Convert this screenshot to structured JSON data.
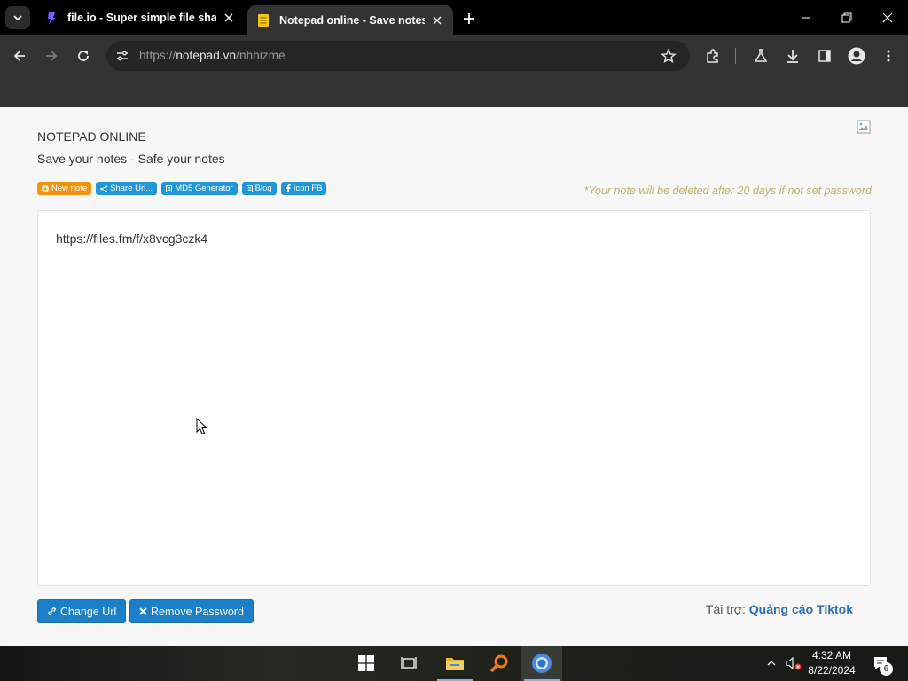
{
  "browser": {
    "tabs": [
      {
        "title": "file.io - Super simple file sharing",
        "active": false
      },
      {
        "title": "Notepad online - Save notes online",
        "active": true
      }
    ],
    "url_scheme": "https://",
    "url_host": "notepad.vn",
    "url_path": "/nhhizme"
  },
  "page": {
    "brand": "NOTEPAD ONLINE",
    "tagline": "Save your notes - Safe your notes",
    "chips": [
      {
        "label": "New note",
        "icon": "plus-icon",
        "color": "#f0930f"
      },
      {
        "label": "Share Url...",
        "icon": "share-icon",
        "color": "#2196d9"
      },
      {
        "label": "MD5 Generator",
        "icon": "document-icon",
        "color": "#2196d9"
      },
      {
        "label": "Blog",
        "icon": "document-icon",
        "color": "#2196d9"
      },
      {
        "label": "Icon FB",
        "icon": "facebook-icon",
        "color": "#2196d9"
      }
    ],
    "notice": "*Your note will be deleted after 20 days if not set password",
    "note_content": "https://files.fm/f/x8vcg3czk4",
    "buttons": {
      "change_url": "Change Url",
      "remove_password": "Remove Password"
    },
    "sponsor": {
      "label": "Tài trợ:",
      "link": "Quảng cáo Tiktok"
    }
  },
  "taskbar": {
    "time": "4:32 AM",
    "date": "8/22/2024",
    "notification_count": "6"
  }
}
